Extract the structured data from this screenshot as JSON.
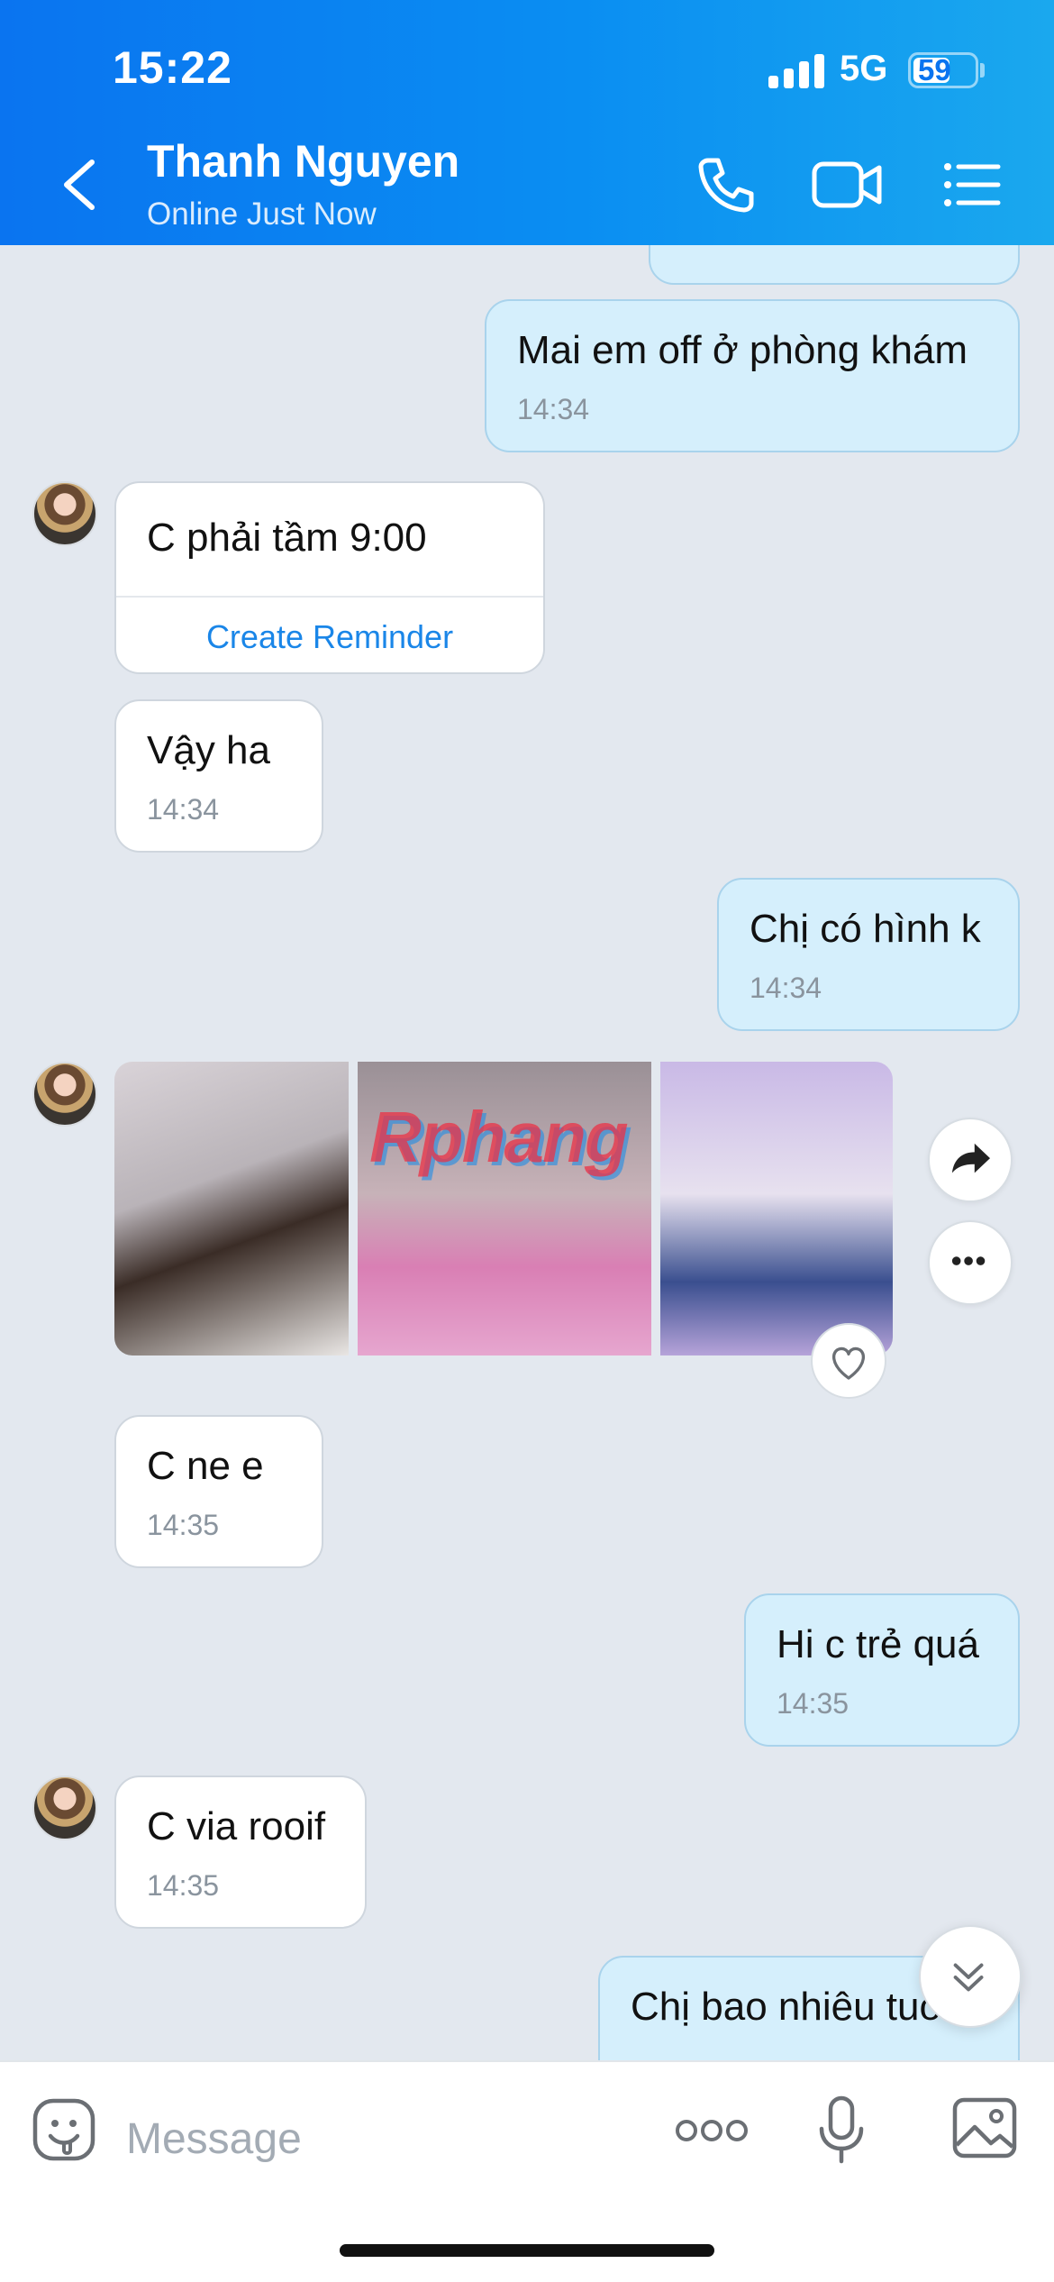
{
  "status_bar": {
    "time": "15:22",
    "network": "5G",
    "battery": "59"
  },
  "header": {
    "contact_name": "Thanh Nguyen",
    "contact_status": "Online Just Now"
  },
  "messages": [
    {
      "dir": "out",
      "text": "Mai em off ở phòng khám",
      "time": "14:34"
    },
    {
      "dir": "in",
      "text": "C phải tầm 9:00",
      "action": "Create Reminder"
    },
    {
      "dir": "in",
      "text": "Vậy ha",
      "time": "14:34"
    },
    {
      "dir": "out",
      "text": "Chị có hình k",
      "time": "14:34"
    },
    {
      "dir": "in",
      "text": "C ne e",
      "time": "14:35"
    },
    {
      "dir": "out",
      "text": "Hi c trẻ quá",
      "time": "14:35"
    },
    {
      "dir": "in",
      "text": "C via rooif",
      "time": "14:35"
    },
    {
      "dir": "out",
      "text": "Chị bao nhiêu tuổi"
    }
  ],
  "photo_watermark": "Rphang",
  "input": {
    "placeholder": "Message"
  },
  "colors": {
    "header_start": "#0a74f0",
    "header_end": "#1aa8ee",
    "outgoing_bubble": "#d5effc",
    "incoming_bubble": "#ffffff",
    "link": "#1a86e8"
  },
  "icons": [
    "back-icon",
    "phone-icon",
    "video-call-icon",
    "menu-list-icon",
    "share-icon",
    "more-icon",
    "heart-icon",
    "scroll-down-icon",
    "sticker-icon",
    "more-dots-icon",
    "microphone-icon",
    "gallery-icon"
  ]
}
